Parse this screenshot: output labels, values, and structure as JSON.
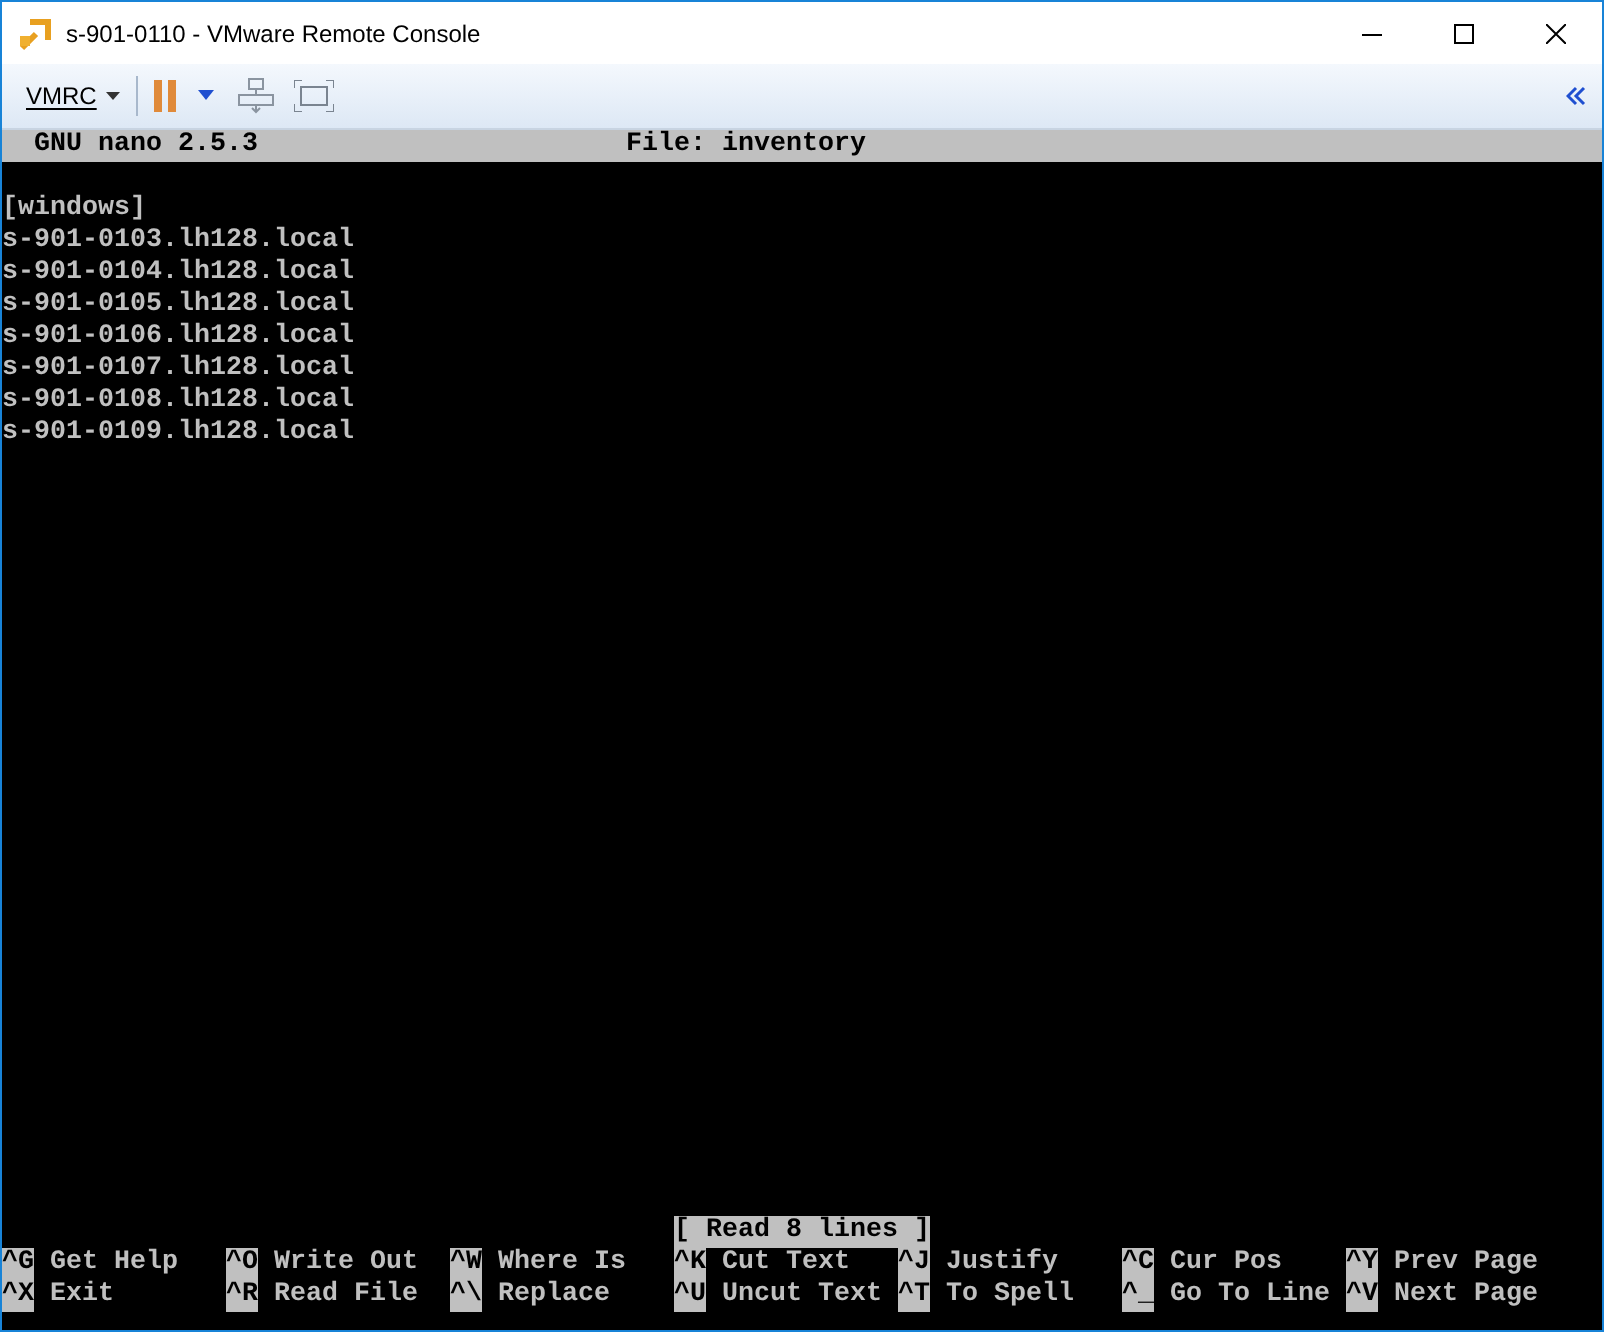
{
  "window": {
    "title": "s-901-0110 - VMware Remote Console"
  },
  "toolbar": {
    "menu": "VMRC"
  },
  "nano": {
    "header_left": "GNU nano 2.5.3",
    "header_file": "File: inventory",
    "lines": [
      "[windows]",
      "s-901-0103.lh128.local",
      "s-901-0104.lh128.local",
      "s-901-0105.lh128.local",
      "s-901-0106.lh128.local",
      "s-901-0107.lh128.local",
      "s-901-0108.lh128.local",
      "s-901-0109.lh128.local"
    ],
    "status": "[ Read 8 lines ]",
    "shortcuts": [
      {
        "key": "^G",
        "label": "Get Help"
      },
      {
        "key": "^O",
        "label": "Write Out"
      },
      {
        "key": "^W",
        "label": "Where Is"
      },
      {
        "key": "^K",
        "label": "Cut Text"
      },
      {
        "key": "^J",
        "label": "Justify"
      },
      {
        "key": "^C",
        "label": "Cur Pos"
      },
      {
        "key": "^Y",
        "label": "Prev Page"
      },
      {
        "key": "^X",
        "label": "Exit"
      },
      {
        "key": "^R",
        "label": "Read File"
      },
      {
        "key": "^\\",
        "label": "Replace"
      },
      {
        "key": "^U",
        "label": "Uncut Text"
      },
      {
        "key": "^T",
        "label": "To Spell"
      },
      {
        "key": "^_",
        "label": "Go To Line"
      },
      {
        "key": "^V",
        "label": "Next Page"
      }
    ]
  }
}
